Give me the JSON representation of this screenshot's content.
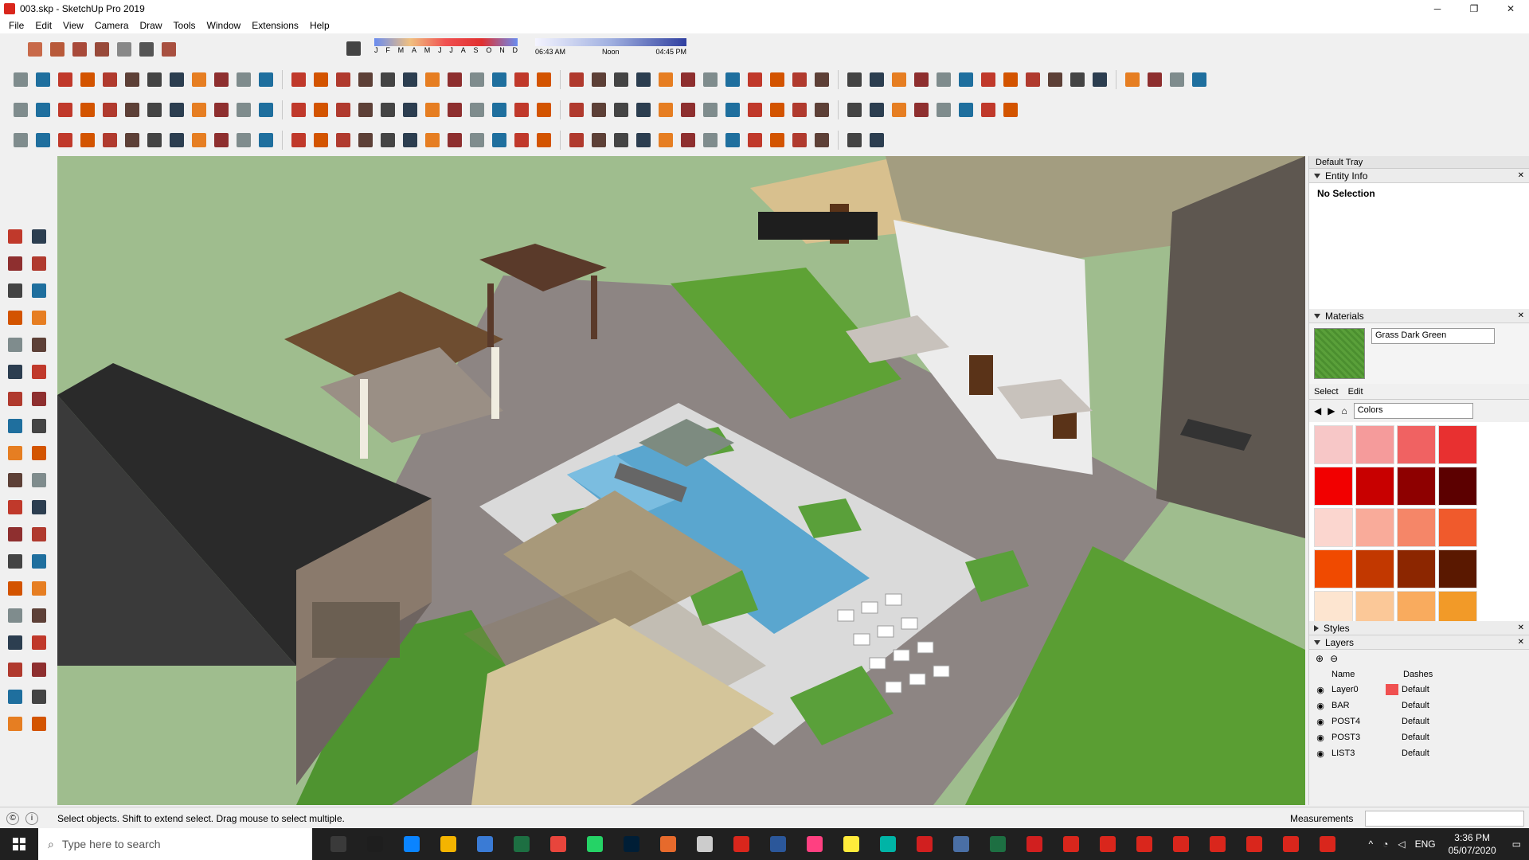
{
  "window": {
    "title": "003.skp - SketchUp Pro 2019"
  },
  "menu": [
    "File",
    "Edit",
    "View",
    "Camera",
    "Draw",
    "Tools",
    "Window",
    "Extensions",
    "Help"
  ],
  "shadows": {
    "months": [
      "J",
      "F",
      "M",
      "A",
      "M",
      "J",
      "J",
      "A",
      "S",
      "O",
      "N",
      "D"
    ],
    "time_start": "06:43 AM",
    "time_mid": "Noon",
    "time_end": "04:45 PM"
  },
  "tray": {
    "title": "Default Tray",
    "entity_info": {
      "header": "Entity Info",
      "value": "No Selection"
    },
    "materials": {
      "header": "Materials",
      "current": "Grass Dark Green",
      "tab_select": "Select",
      "tab_edit": "Edit",
      "library": "Colors",
      "swatches": [
        "#f7c7c7",
        "#f59b9b",
        "#f06262",
        "#e83030",
        "#f20000",
        "#c80000",
        "#8e0000",
        "#5c0000",
        "#fbd6cf",
        "#f9ab9a",
        "#f58668",
        "#f05a2c",
        "#f04a00",
        "#c23800",
        "#8c2600",
        "#5a1800",
        "#fde5d0",
        "#fbc898",
        "#f9ab5e",
        "#f29a28"
      ]
    },
    "styles": {
      "header": "Styles"
    },
    "layers": {
      "header": "Layers",
      "col_name": "Name",
      "col_dashes": "Dashes",
      "rows": [
        {
          "name": "Layer0",
          "dashes": "Default",
          "color": "#f05050"
        },
        {
          "name": "BAR",
          "dashes": "Default",
          "color": ""
        },
        {
          "name": "POST4",
          "dashes": "Default",
          "color": ""
        },
        {
          "name": "POST3",
          "dashes": "Default",
          "color": ""
        },
        {
          "name": "LIST3",
          "dashes": "Default",
          "color": ""
        }
      ]
    }
  },
  "status": {
    "hint": "Select objects. Shift to extend select. Drag mouse to select multiple.",
    "measurements_label": "Measurements"
  },
  "taskbar": {
    "search_placeholder": "Type here to search",
    "lang": "ENG",
    "time": "3:36 PM",
    "date": "05/07/2020"
  },
  "colors": {
    "accent": "#d9261c",
    "grass": "#5aa03a",
    "pool": "#5aa6cf"
  }
}
